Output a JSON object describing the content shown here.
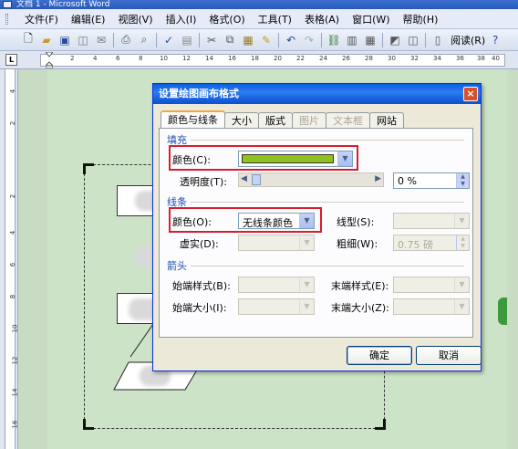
{
  "window": {
    "title": "文档 1 - Microsoft Word"
  },
  "menubar": {
    "items": [
      "文件(F)",
      "编辑(E)",
      "视图(V)",
      "插入(I)",
      "格式(O)",
      "工具(T)",
      "表格(A)",
      "窗口(W)",
      "帮助(H)"
    ]
  },
  "toolbar": {
    "read_label": "阅读(R)"
  },
  "ruler": {
    "corner": "L",
    "ticks": [
      "2",
      "4",
      "6",
      "8",
      "10",
      "12",
      "14",
      "16",
      "18",
      "20",
      "22",
      "24",
      "26",
      "28",
      "30",
      "32",
      "34",
      "36",
      "38",
      "40"
    ],
    "vticks": [
      "4",
      "2",
      "2",
      "4",
      "6",
      "8",
      "10",
      "12",
      "14",
      "16"
    ]
  },
  "dialog": {
    "title": "设置绘图画布格式",
    "close": "×",
    "tabs": [
      "颜色与线条",
      "大小",
      "版式",
      "图片",
      "文本框",
      "网站"
    ],
    "fill": {
      "section": "填充",
      "color_label": "颜色(C):",
      "color_value": "#8dc21f",
      "transparency_label": "透明度(T):",
      "transparency_value": "0 %"
    },
    "line": {
      "section": "线条",
      "color_label": "颜色(O):",
      "color_value": "无线条颜色",
      "style_label": "线型(S):",
      "dashed_label": "虚实(D):",
      "weight_label": "粗细(W):",
      "weight_value": "0.75 磅"
    },
    "arrows": {
      "section": "箭头",
      "begin_style_label": "始端样式(B):",
      "end_style_label": "末端样式(E):",
      "begin_size_label": "始端大小(I):",
      "end_size_label": "末端大小(Z):"
    },
    "ok": "确定",
    "cancel": "取消"
  },
  "colors": {
    "highlight": "#d61e2e",
    "accent": "#0a5fe2"
  }
}
